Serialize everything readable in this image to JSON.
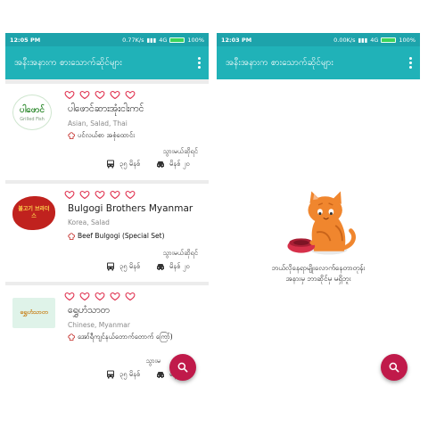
{
  "left_screen": {
    "status": {
      "time": "12:05 PM",
      "speed": "0.77K/s",
      "network": "4G",
      "battery": "100%"
    },
    "title": "အနီးအနားက စားသောက်ဆိုင်များ",
    "restaurants": [
      {
        "logo_text": "ပါဖောင်",
        "logo_sub": "Grilled Fish",
        "name": "ပါဖောင်ဆားအုံးငါးကင်",
        "cuisine": "Asian, Salad, Thai",
        "recommended": "ပင်လယ်စာ အစုံထောင်း",
        "go_label": "သွားမယ်ဆိုရင်",
        "bus_time": "၃၅ မိနစ်",
        "car_time": "မိနစ် ၂၀"
      },
      {
        "logo_text": "불고기 브라더스",
        "name": "Bulgogi Brothers Myanmar",
        "cuisine": "Korea, Salad",
        "recommended": "Beef Bulgogi (Special Set)",
        "go_label": "သွားမယ်ဆိုရင်",
        "bus_time": "၃၅ မိနစ်",
        "car_time": "မိနစ် ၂၀"
      },
      {
        "logo_text": "ရွှေဟံသာတ",
        "name": "ရွှေဟံသာတ",
        "cuisine": "Chinese, Myanmar",
        "recommended": "အော်ရီကျင်နယ်တောက်တောက် ကြော်)",
        "go_label": "သွားမ",
        "bus_time": "၃၅ မိနစ်",
        "car_time": "မိနစ်"
      }
    ]
  },
  "right_screen": {
    "status": {
      "time": "12:03 PM",
      "speed": "0.00K/s",
      "network": "4G",
      "battery": "100%"
    },
    "title": "အနီးအနားက စားသောက်ဆိုင်များ",
    "empty_line1": "ဘယ်လိုနေရာမျိုးလောက်နေတာတုန်း",
    "empty_line2": "အနားမှ ဘာဆိုင်မှ မရှိဘူး"
  },
  "colors": {
    "appbar": "#20b2b8",
    "statusbar": "#1da3ab",
    "heart": "#e0314f",
    "fab": "#c01a4a",
    "cat": "#f0862e"
  }
}
